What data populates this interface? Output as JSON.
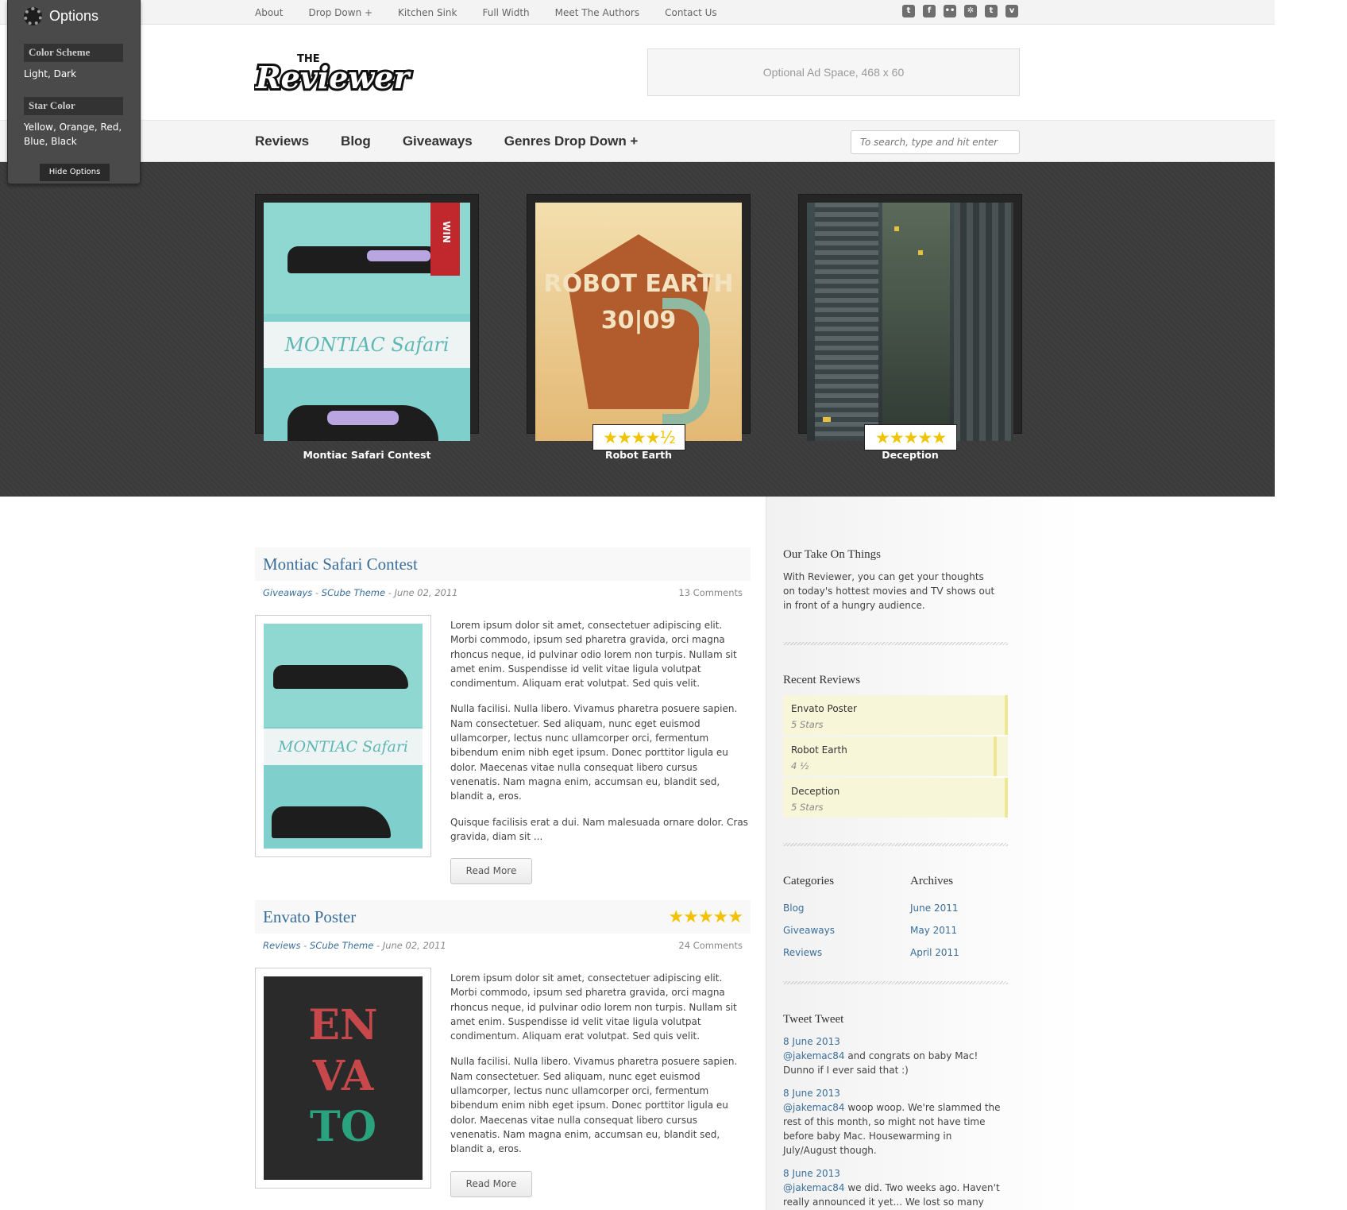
{
  "topnav": {
    "items": [
      "About",
      "Drop Down +",
      "Kitchen Sink",
      "Full Width",
      "Meet The Authors",
      "Contact Us"
    ]
  },
  "social": {
    "icons": [
      "twitter-icon",
      "facebook-icon",
      "flickr-icon",
      "dribbble-icon",
      "tumblr-icon",
      "vimeo-icon"
    ],
    "glyphs": [
      "t",
      "f",
      "••",
      "✲",
      "t",
      "v"
    ]
  },
  "header": {
    "logo_top": "THE",
    "logo_main": "Reviewer",
    "ad_text": "Optional Ad Space, 468 x 60"
  },
  "mainnav": {
    "items": [
      "Reviews",
      "Blog",
      "Giveaways",
      "Genres Drop Down +"
    ],
    "search_placeholder": "To search, type and hit enter"
  },
  "options": {
    "title": "Options",
    "color_scheme_label": "Color Scheme",
    "color_scheme_values": "Light, Dark",
    "star_color_label": "Star Color",
    "star_color_values": "Yellow, Orange, Red, Blue, Black",
    "hide_label": "Hide Options"
  },
  "featured": [
    {
      "caption": "Montiac Safari Contest",
      "ribbon": "WIN",
      "poster_text": "MONTIAC Safari"
    },
    {
      "caption": "Robot Earth",
      "stars": "★★★★½",
      "rating": 4.5,
      "poster_text": "ROBOT EARTH 30|09"
    },
    {
      "caption": "Deception",
      "stars": "★★★★★",
      "rating": 5
    }
  ],
  "posts": [
    {
      "title": "Montiac Safari Contest",
      "category": "Giveaways",
      "author": "SCube Theme",
      "date": "June 02, 2011",
      "comments": "13 Comments",
      "sep1": " - ",
      "sep2": " - ",
      "paragraphs": [
        "Lorem ipsum dolor sit amet, consectetuer adipiscing elit. Morbi commodo, ipsum sed pharetra gravida, orci magna rhoncus neque, id pulvinar odio lorem non turpis. Nullam sit amet enim. Suspendisse id velit vitae ligula volutpat condimentum. Aliquam erat volutpat. Sed quis velit.",
        "Nulla facilisi. Nulla libero. Vivamus pharetra posuere sapien. Nam consectetuer. Sed aliquam, nunc eget euismod ullamcorper, lectus nunc ullamcorper orci, fermentum bibendum enim nibh eget ipsum. Donec porttitor ligula eu dolor. Maecenas vitae nulla consequat libero cursus venenatis. Nam magna enim, accumsan eu, blandit sed, blandit a, eros.",
        "Quisque facilisis erat a dui. Nam malesuada ornare dolor. Cras gravida, diam sit ..."
      ],
      "read_more": "Read More",
      "poster_text": "MONTIAC Safari"
    },
    {
      "title": "Envato Poster",
      "stars": "★★★★★",
      "rating": 5,
      "category": "Reviews",
      "author": "SCube Theme",
      "date": "June 02, 2011",
      "comments": "24 Comments",
      "sep1": " - ",
      "sep2": " - ",
      "paragraphs": [
        "Lorem ipsum dolor sit amet, consectetuer adipiscing elit. Morbi commodo, ipsum sed pharetra gravida, orci magna rhoncus neque, id pulvinar odio lorem non turpis. Nullam sit amet enim. Suspendisse id velit vitae ligula volutpat condimentum. Aliquam erat volutpat. Sed quis velit.",
        "Nulla facilisi. Nulla libero. Vivamus pharetra posuere sapien. Nam consectetuer. Sed aliquam, nunc eget euismod ullamcorper, lectus nunc ullamcorper orci, fermentum bibendum enim nibh eget ipsum. Donec porttitor ligula eu dolor. Maecenas vitae nulla consequat libero cursus venenatis. Nam magna enim, accumsan eu, blandit sed, blandit a, eros."
      ],
      "read_more": "Read More",
      "poster_text": [
        "EN",
        "VA",
        "TO"
      ]
    }
  ],
  "sidebar": {
    "take": {
      "title": "Our Take On Things",
      "text": "With Reviewer, you can get your thoughts on today's hottest movies and TV shows out in front of a hungry audience."
    },
    "recent": {
      "title": "Recent Reviews",
      "items": [
        {
          "name": "Envato Poster",
          "rating": "5 Stars"
        },
        {
          "name": "Robot Earth",
          "rating": "4 ½"
        },
        {
          "name": "Deception",
          "rating": "5 Stars"
        }
      ]
    },
    "categories": {
      "title": "Categories",
      "items": [
        "Blog",
        "Giveaways",
        "Reviews"
      ]
    },
    "archives": {
      "title": "Archives",
      "items": [
        "June 2011",
        "May 2011",
        "April 2011"
      ]
    },
    "tweets": {
      "title": "Tweet Tweet",
      "items": [
        {
          "date": "8 June 2013",
          "user": "@jakemac84",
          "text": " and congrats on baby Mac! Dunno if I ever said that :)"
        },
        {
          "date": "8 June 2013",
          "user": "@jakemac84",
          "text": " woop woop. We're slammed the rest of this month, so might not have time before baby Mac. Housewarming in July/August though."
        },
        {
          "date": "8 June 2013",
          "user": "@jakemac84",
          "text": " we did. Two weeks ago. Haven't really announced it yet... We lost so many houses before we kept things quiet this time."
        }
      ]
    }
  },
  "colors": {
    "link": "#3a6e9a",
    "star": "#f2c200",
    "dark_band": "#3b3b3b",
    "ribbon": "#c0282d"
  }
}
